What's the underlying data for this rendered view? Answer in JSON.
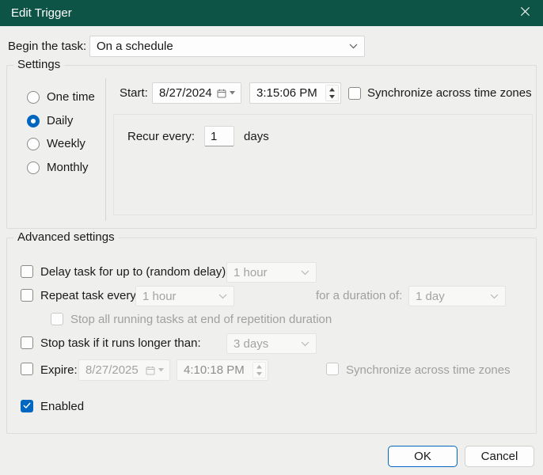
{
  "window": {
    "title": "Edit Trigger"
  },
  "begin": {
    "label": "Begin the task:",
    "value": "On a schedule"
  },
  "settings": {
    "legend": "Settings",
    "radios": [
      {
        "label": "One time",
        "selected": false
      },
      {
        "label": "Daily",
        "selected": true
      },
      {
        "label": "Weekly",
        "selected": false
      },
      {
        "label": "Monthly",
        "selected": false
      }
    ],
    "start_label": "Start:",
    "start_date": "8/27/2024",
    "start_time": "3:15:06 PM",
    "sync_label": "Synchronize across time zones",
    "recur_label": "Recur every:",
    "recur_value": "1",
    "recur_unit": "days"
  },
  "advanced": {
    "legend": "Advanced settings",
    "delay_label": "Delay task for up to (random delay):",
    "delay_value": "1 hour",
    "repeat_label": "Repeat task every:",
    "repeat_value": "1 hour",
    "duration_label": "for a duration of:",
    "duration_value": "1 day",
    "stop_all_label": "Stop all running tasks at end of repetition duration",
    "stop_task_label": "Stop task if it runs longer than:",
    "stop_task_value": "3 days",
    "expire_label": "Expire:",
    "expire_date": "8/27/2025",
    "expire_time": "4:10:18 PM",
    "expire_sync_label": "Synchronize across time zones",
    "enabled_label": "Enabled"
  },
  "footer": {
    "ok_label": "OK",
    "cancel_label": "Cancel"
  },
  "colors": {
    "titlebar": "#0d5446",
    "accent": "#0067c0"
  }
}
